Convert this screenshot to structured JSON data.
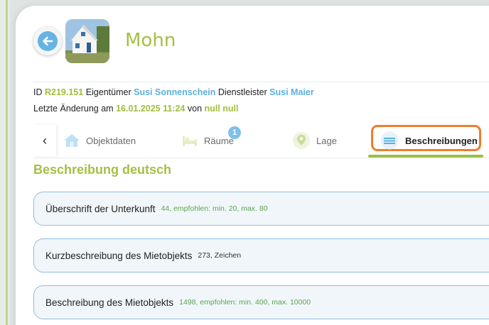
{
  "header": {
    "title": "Mohn",
    "back_icon": "arrow-left-icon",
    "thumbnail_icon": "house-photo"
  },
  "meta": {
    "id_label": "ID",
    "id_value": "R219.151",
    "owner_label": "Eigentümer",
    "owner_value": "Susi Sonnenschein",
    "provider_label": "Dienstleister",
    "provider_value": "Susi Maier",
    "changed_label": "Letzte Änderung am",
    "changed_value": "16.01.2025 11:24",
    "by_label": "von",
    "by_value": "null null"
  },
  "tabs": [
    {
      "label": "Objektdaten",
      "icon": "house-icon"
    },
    {
      "label": "Räume",
      "icon": "bed-icon",
      "badge": "1"
    },
    {
      "label": "Lage",
      "icon": "map-pin-icon"
    },
    {
      "label": "Beschreibungen",
      "icon": "lines-icon",
      "active": true
    }
  ],
  "tabs_prev": "‹",
  "section": {
    "title": "Beschreibung deutsch"
  },
  "rows": [
    {
      "label": "Überschrift der Unterkunft",
      "info": "44, empfohlen: min. 20, max. 80"
    },
    {
      "label": "Kurzbeschreibung des Mietobjekts",
      "info": "273, Zeichen"
    },
    {
      "label": "Beschreibung des Mietobjekts",
      "info": "1498, empfohlen: min. 400, max. 10000"
    }
  ],
  "colors": {
    "accent_green": "#a4c045",
    "accent_blue": "#5ab0df",
    "highlight_orange": "#f07c2c"
  }
}
